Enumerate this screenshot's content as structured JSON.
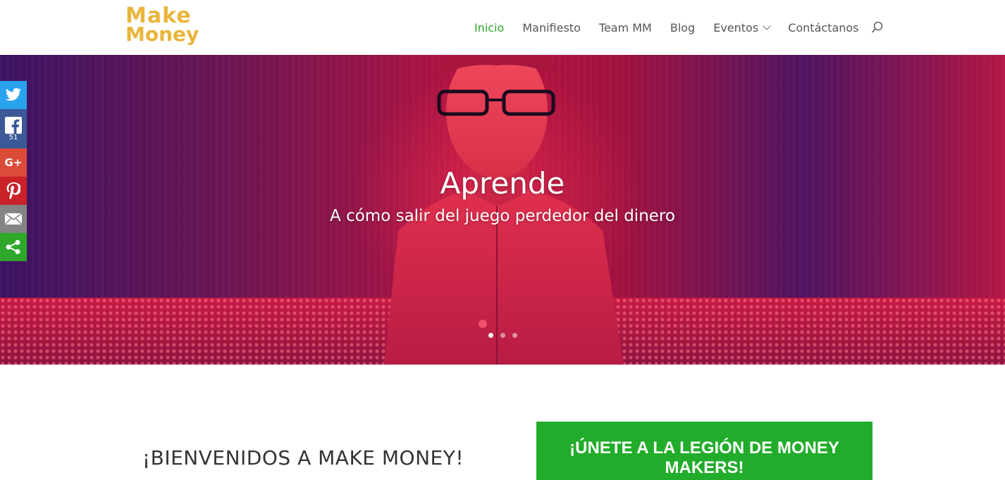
{
  "logo": {
    "line1": "Make",
    "line2": "Money"
  },
  "nav": {
    "items": [
      {
        "label": "Inicio",
        "active": true
      },
      {
        "label": "Manifiesto"
      },
      {
        "label": "Team MM"
      },
      {
        "label": "Blog"
      },
      {
        "label": "Eventos",
        "has_dropdown": true
      },
      {
        "label": "Contáctanos"
      }
    ],
    "search_icon": "search-icon"
  },
  "hero": {
    "title": "Aprende",
    "subtitle": "A cómo salir del juego perdedor del dinero",
    "slides": 3,
    "active_slide": 1
  },
  "social": {
    "facebook_count": "51",
    "colors": {
      "twitter": "#2aa3ef",
      "facebook": "#3b5998",
      "google": "#dc4a38",
      "pinterest": "#cb2128",
      "email": "#848484",
      "more": "#2ea72b"
    },
    "google_label": "G+"
  },
  "content": {
    "welcome": "¡BIENVENIDOS A MAKE MONEY!",
    "cta_title": "¡ÚNETE A LA LEGIÓN DE MONEY MAKERS!"
  },
  "colors": {
    "accent": "#2ea72b",
    "logo": "#e9b53a"
  }
}
